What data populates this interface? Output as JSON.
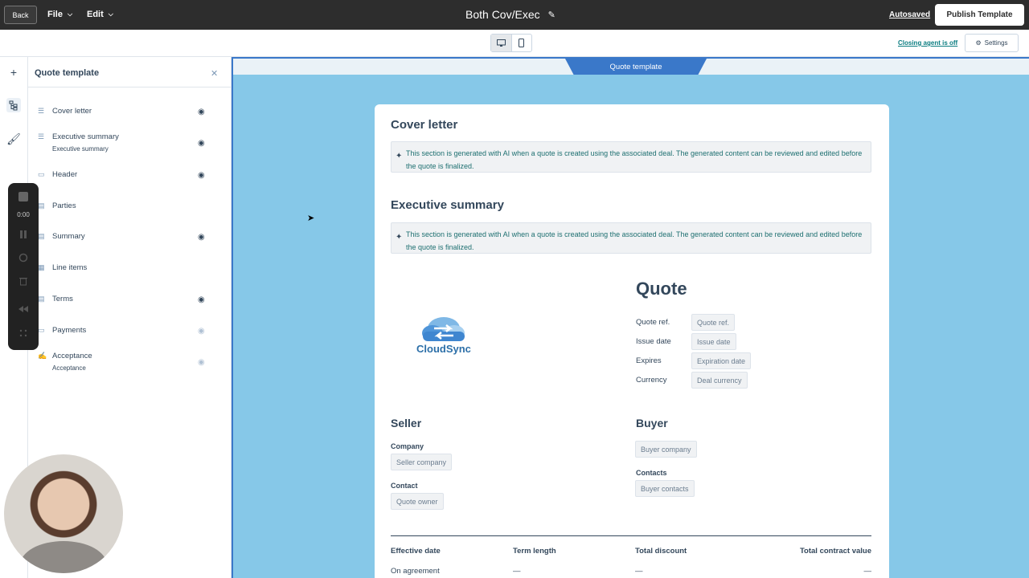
{
  "topbar": {
    "back_label": "Back",
    "file_label": "File",
    "edit_label": "Edit",
    "title": "Both Cov/Exec",
    "autosaved_label": "Autosaved",
    "publish_label": "Publish Template"
  },
  "subbar": {
    "closing_agent_label": "Closing agent is off",
    "settings_label": "Settings"
  },
  "panel": {
    "title": "Quote template",
    "sections": [
      {
        "label": "Cover letter",
        "sub": "",
        "eye": "visible"
      },
      {
        "label": "Executive summary",
        "sub": "Executive summary",
        "eye": "visible"
      },
      {
        "label": "Header",
        "sub": "",
        "eye": "visible"
      },
      {
        "label": "Parties",
        "sub": "",
        "eye": "none"
      },
      {
        "label": "Summary",
        "sub": "",
        "eye": "visible"
      },
      {
        "label": "Line items",
        "sub": "",
        "eye": "none"
      },
      {
        "label": "Terms",
        "sub": "",
        "eye": "visible"
      },
      {
        "label": "Payments",
        "sub": "",
        "eye": "faint"
      },
      {
        "label": "Acceptance",
        "sub": "Acceptance",
        "eye": "faint"
      }
    ]
  },
  "recorder": {
    "time": "0:00"
  },
  "canvas": {
    "tab_label": "Quote template",
    "cover_letter": {
      "title": "Cover letter",
      "ai_text": "This section is generated with AI when a quote is created using the associated deal. The generated content can be reviewed and edited before the quote is finalized."
    },
    "executive_summary": {
      "title": "Executive summary",
      "ai_text": "This section is generated with AI when a quote is created using the associated deal. The generated content can be reviewed and edited before the quote is finalized."
    },
    "logo_word": "CloudSync",
    "quote": {
      "title": "Quote",
      "fields": [
        {
          "label": "Quote ref.",
          "value": "Quote ref."
        },
        {
          "label": "Issue date",
          "value": "Issue date"
        },
        {
          "label": "Expires",
          "value": "Expiration date"
        },
        {
          "label": "Currency",
          "value": "Deal currency"
        }
      ]
    },
    "seller": {
      "title": "Seller",
      "company_label": "Company",
      "company_value": "Seller company",
      "contact_label": "Contact",
      "contact_value": "Quote owner"
    },
    "buyer": {
      "title": "Buyer",
      "company_value": "Buyer company",
      "contacts_label": "Contacts",
      "contacts_value": "Buyer contacts"
    },
    "summary": {
      "headers": [
        "Effective date",
        "Term length",
        "Total discount",
        "Total contract value"
      ],
      "values": [
        "On agreement",
        "—",
        "—",
        "—"
      ]
    }
  },
  "colors": {
    "topbar_bg": "#2d2d2d",
    "canvas_bg": "#86c8e8",
    "accent_blue": "#3a78c9",
    "ai_text": "#1d6f70"
  }
}
